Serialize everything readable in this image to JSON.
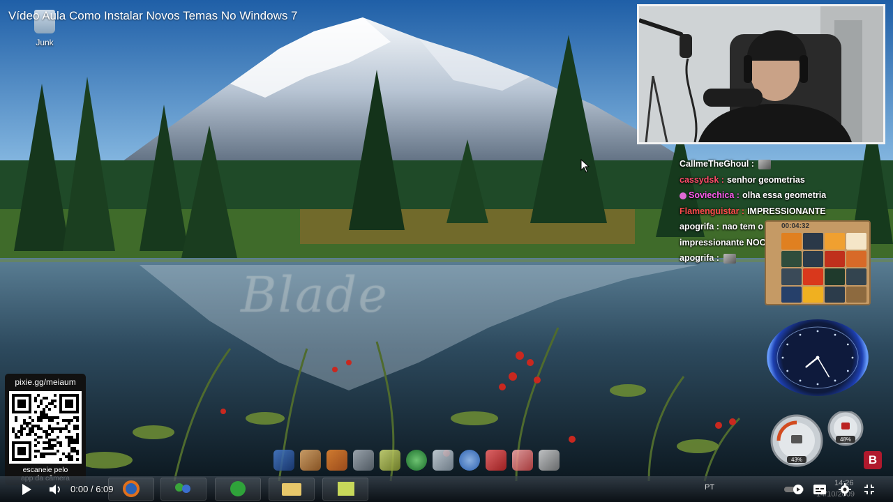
{
  "video": {
    "title": "Vídeo Aula Como Instalar Novos Temas No Windows 7",
    "current_time": "0:00",
    "duration": "6:09",
    "time_separator": "/"
  },
  "desktop": {
    "icons": [
      {
        "label": "Junk",
        "icon": "recycle-bin-icon"
      }
    ],
    "watermark": "Blade",
    "language": "PT",
    "tray_time": "14:26",
    "tray_date": "14/10/2009"
  },
  "chat": {
    "messages": [
      {
        "user": "CallmeTheGhoul :",
        "text": "",
        "user_color": "#ffffff",
        "emote": true,
        "badge": false
      },
      {
        "user": "cassydsk :",
        "text": "senhor geometrias",
        "user_color": "#ff4d6a",
        "emote": false,
        "badge": false
      },
      {
        "user": "Soviechica :",
        "text": "olha essa geometria",
        "user_color": "#ff5cf0",
        "emote": false,
        "badge": true
      },
      {
        "user": "Flamenguistar :",
        "text": "IMPRESSIONANTE",
        "user_color": "#ff4d4d",
        "emote": false,
        "badge": false
      },
      {
        "user": "apogrifa :",
        "text": "nao tem o",
        "user_color": "#ffffff",
        "emote": false,
        "badge": false
      },
      {
        "user": "",
        "text": "impressionante NOOO",
        "user_color": "#ffffff",
        "emote": false,
        "badge": false
      },
      {
        "user": "apogrifa :",
        "text": "",
        "user_color": "#ffffff",
        "emote": true,
        "badge": false
      }
    ]
  },
  "gadgets": {
    "puzzle_timer": "00:04:32",
    "clock": {
      "hour": 7,
      "minute": 26
    },
    "meters": {
      "cpu_percent": "43%",
      "memory_percent": "48%"
    }
  },
  "pixie": {
    "url": "pixie.gg/meiaum",
    "hint_line1": "escaneie pelo",
    "hint_line2": "app da câmera"
  },
  "channel": {
    "badge_letter": "B"
  },
  "colors": {
    "accent": "#b0192d",
    "chat_text": "#ffffff",
    "taskbar": "#1a232c"
  },
  "icons": {
    "play": "play-icon",
    "volume": "volume-icon",
    "autoplay": "autoplay-toggle-icon",
    "captions": "captions-icon",
    "settings": "gear-icon",
    "fullscreen": "exit-fullscreen-icon"
  }
}
